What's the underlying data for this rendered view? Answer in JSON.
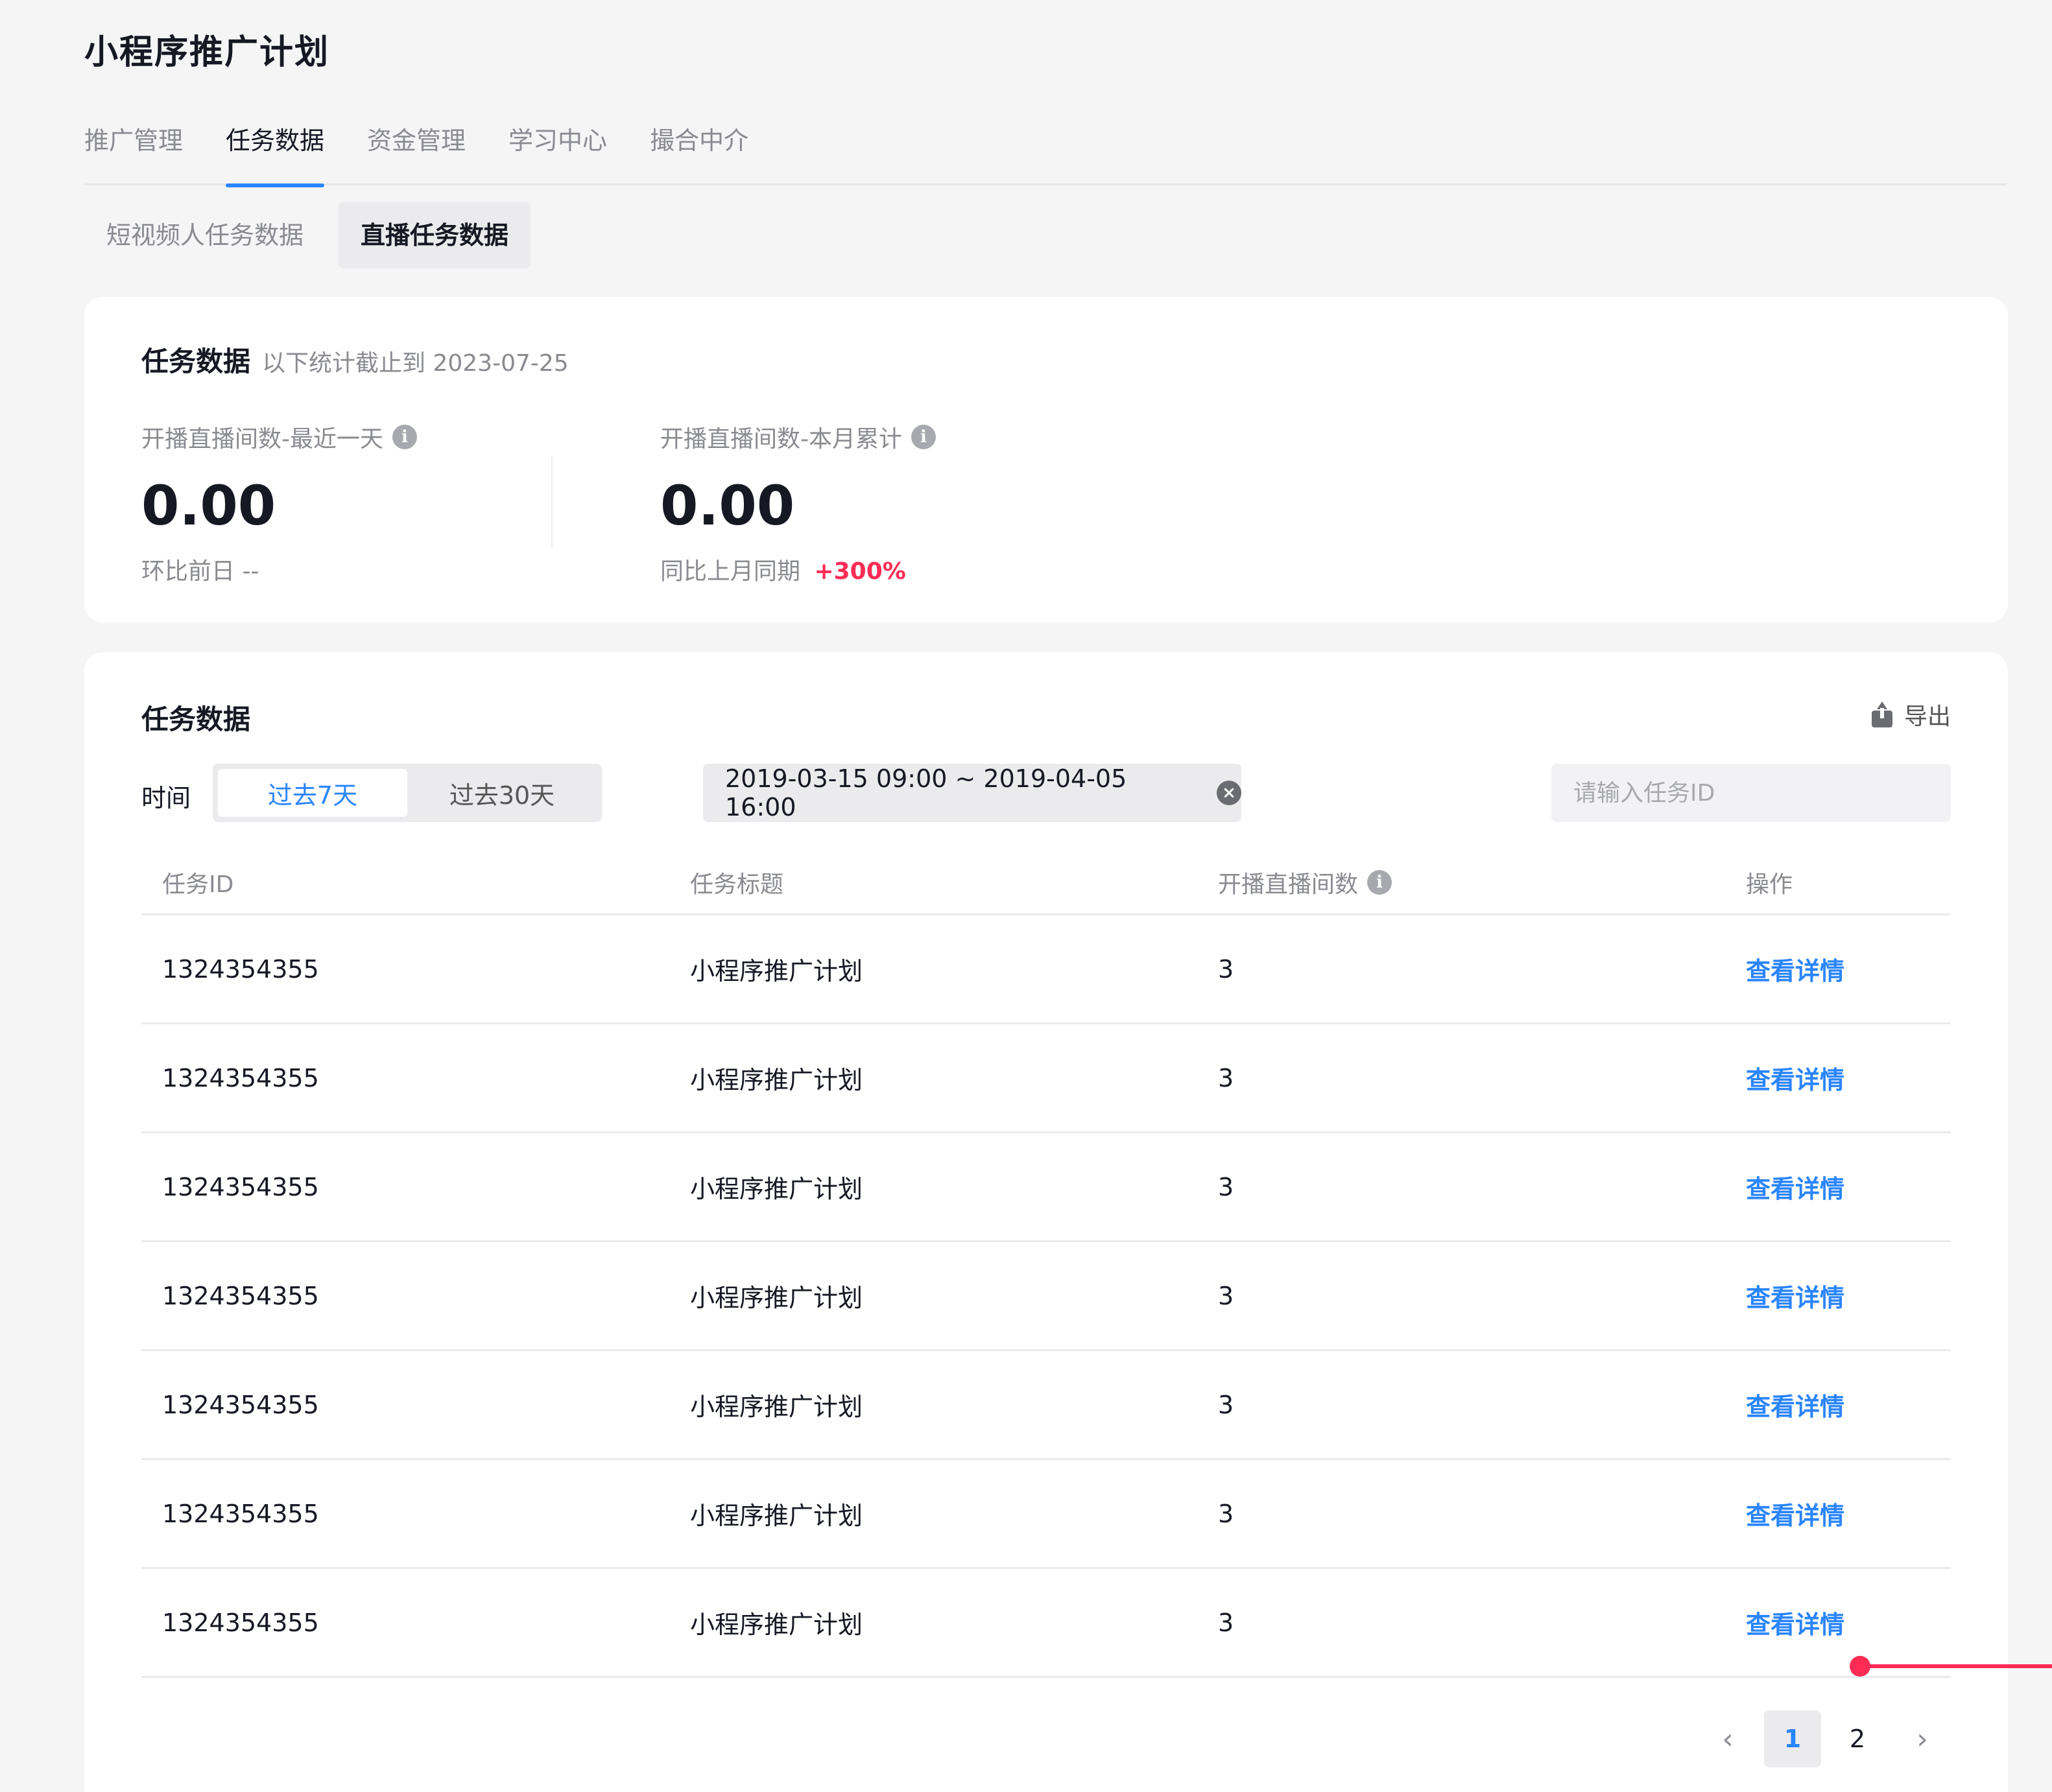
{
  "page": {
    "title": "小程序推广计划"
  },
  "main_tabs": [
    {
      "label": "推广管理"
    },
    {
      "label": "任务数据"
    },
    {
      "label": "资金管理"
    },
    {
      "label": "学习中心"
    },
    {
      "label": "撮合中介"
    }
  ],
  "main_tabs_active_index": 1,
  "sub_tabs": [
    {
      "label": "短视频人任务数据"
    },
    {
      "label": "直播任务数据"
    }
  ],
  "sub_tabs_active_index": 1,
  "stats": {
    "title": "任务数据",
    "subtitle": "以下统计截止到 2023-07-25",
    "metrics": [
      {
        "label": "开播直播间数-最近一天",
        "value": "0.00",
        "compare_label": "环比前日",
        "compare_value": "--"
      },
      {
        "label": "开播直播间数-本月累计",
        "value": "0.00",
        "compare_label": "同比上月同期",
        "compare_value": "+300%"
      }
    ]
  },
  "table_card": {
    "title": "任务数据",
    "export_label": "导出",
    "filter_label": "时间",
    "range_options": [
      {
        "label": "过去7天"
      },
      {
        "label": "过去30天"
      }
    ],
    "range_active_index": 0,
    "date_range": "2019-03-15 09:00 ~ 2019-04-05 16:00",
    "search_placeholder": "请输入任务ID",
    "search_value": ""
  },
  "table": {
    "columns": [
      "任务ID",
      "任务标题",
      "开播直播间数",
      "操作"
    ],
    "rows": [
      {
        "id": "1324354355",
        "title": "小程序推广计划",
        "count": "3",
        "action": "查看详情"
      },
      {
        "id": "1324354355",
        "title": "小程序推广计划",
        "count": "3",
        "action": "查看详情"
      },
      {
        "id": "1324354355",
        "title": "小程序推广计划",
        "count": "3",
        "action": "查看详情"
      },
      {
        "id": "1324354355",
        "title": "小程序推广计划",
        "count": "3",
        "action": "查看详情"
      },
      {
        "id": "1324354355",
        "title": "小程序推广计划",
        "count": "3",
        "action": "查看详情"
      },
      {
        "id": "1324354355",
        "title": "小程序推广计划",
        "count": "3",
        "action": "查看详情"
      },
      {
        "id": "1324354355",
        "title": "小程序推广计划",
        "count": "3",
        "action": "查看详情"
      }
    ]
  },
  "pagination": {
    "prev": "‹",
    "next": "›",
    "pages": [
      "1",
      "2"
    ],
    "current": "1"
  },
  "colors": {
    "accent": "#2a85ff",
    "positive": "#fe2c55",
    "annotation": "#fe2c55"
  }
}
